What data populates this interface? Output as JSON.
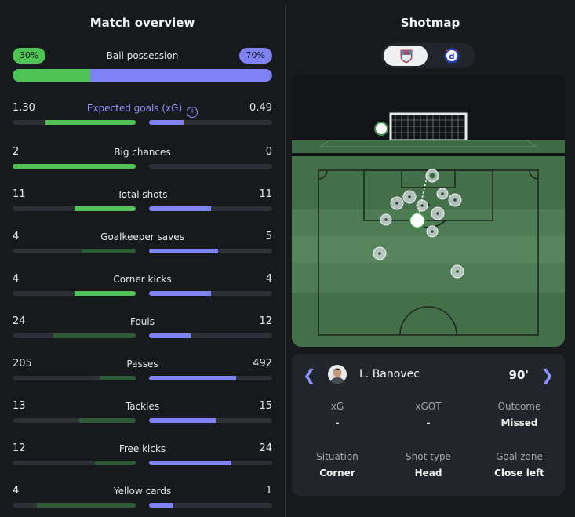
{
  "overview": {
    "title": "Match overview",
    "possession": {
      "label": "Ball possession",
      "home": "30%",
      "away": "70%",
      "home_fraction": 0.3
    },
    "stats": [
      {
        "label": "Expected goals (xG)",
        "home": "1.30",
        "away": "0.49",
        "home_fraction": 0.73,
        "away_fraction": 0.28,
        "winner": "home",
        "info": true
      },
      {
        "label": "Big chances",
        "home": "2",
        "away": "0",
        "home_fraction": 1.0,
        "away_fraction": 0.0,
        "winner": "home"
      },
      {
        "label": "Total shots",
        "home": "11",
        "away": "11",
        "home_fraction": 0.5,
        "away_fraction": 0.5,
        "winner": "both"
      },
      {
        "label": "Goalkeeper saves",
        "home": "4",
        "away": "5",
        "home_fraction": 0.44,
        "away_fraction": 0.56,
        "winner": "away"
      },
      {
        "label": "Corner kicks",
        "home": "4",
        "away": "4",
        "home_fraction": 0.5,
        "away_fraction": 0.5,
        "winner": "both"
      },
      {
        "label": "Fouls",
        "home": "24",
        "away": "12",
        "home_fraction": 0.67,
        "away_fraction": 0.34,
        "winner": "away"
      },
      {
        "label": "Passes",
        "home": "205",
        "away": "492",
        "home_fraction": 0.29,
        "away_fraction": 0.71,
        "winner": "away"
      },
      {
        "label": "Tackles",
        "home": "13",
        "away": "15",
        "home_fraction": 0.46,
        "away_fraction": 0.54,
        "winner": "away"
      },
      {
        "label": "Free kicks",
        "home": "12",
        "away": "24",
        "home_fraction": 0.33,
        "away_fraction": 0.67,
        "winner": "away"
      },
      {
        "label": "Yellow cards",
        "home": "4",
        "away": "1",
        "home_fraction": 0.8,
        "away_fraction": 0.2,
        "winner": "away"
      }
    ]
  },
  "shotmap": {
    "title": "Shotmap",
    "teams": [
      {
        "name": "home-crest",
        "selected": true
      },
      {
        "name": "away-crest",
        "selected": false
      }
    ],
    "selected_shot": {
      "player": "L. Banovec",
      "minute": "90'",
      "xg_label": "xG",
      "xg": "-",
      "xgot_label": "xGOT",
      "xgot": "-",
      "outcome_label": "Outcome",
      "outcome": "Missed",
      "situation_label": "Situation",
      "situation": "Corner",
      "shot_type_label": "Shot type",
      "shot_type": "Head",
      "goal_zone_label": "Goal zone",
      "goal_zone": "Close left"
    }
  },
  "colors": {
    "home": "#4fc256",
    "away": "#7f82f3",
    "accent": "#8e92ff"
  },
  "icons": {
    "prev": "chevron-left-icon",
    "next": "chevron-right-icon",
    "info": "info-icon"
  }
}
